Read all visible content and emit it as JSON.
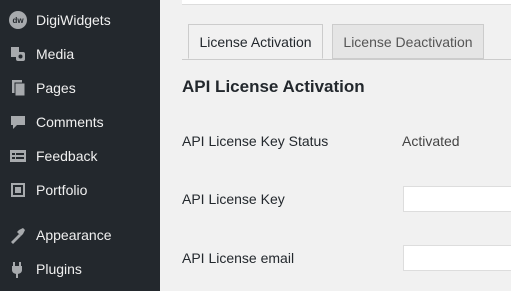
{
  "sidebar": {
    "items": [
      {
        "label": "DigiWidgets",
        "icon": "dw-logo-icon"
      },
      {
        "label": "Media",
        "icon": "media-icon"
      },
      {
        "label": "Pages",
        "icon": "pages-icon"
      },
      {
        "label": "Comments",
        "icon": "comments-icon"
      },
      {
        "label": "Feedback",
        "icon": "feedback-icon"
      },
      {
        "label": "Portfolio",
        "icon": "portfolio-icon"
      },
      {
        "label": "Appearance",
        "icon": "appearance-icon"
      },
      {
        "label": "Plugins",
        "icon": "plugins-icon"
      }
    ],
    "logo_text": "dw"
  },
  "tabs": [
    {
      "label": "License Activation",
      "active": true
    },
    {
      "label": "License Deactivation",
      "active": false
    }
  ],
  "section": {
    "title": "API License Activation",
    "rows": {
      "status_label": "API License Key Status",
      "status_value": "Activated",
      "key_label": "API License Key",
      "key_value": "",
      "email_label": "API License email",
      "email_value": ""
    }
  },
  "colors": {
    "sidebar_bg": "#23282d",
    "page_bg": "#f1f1f1"
  }
}
